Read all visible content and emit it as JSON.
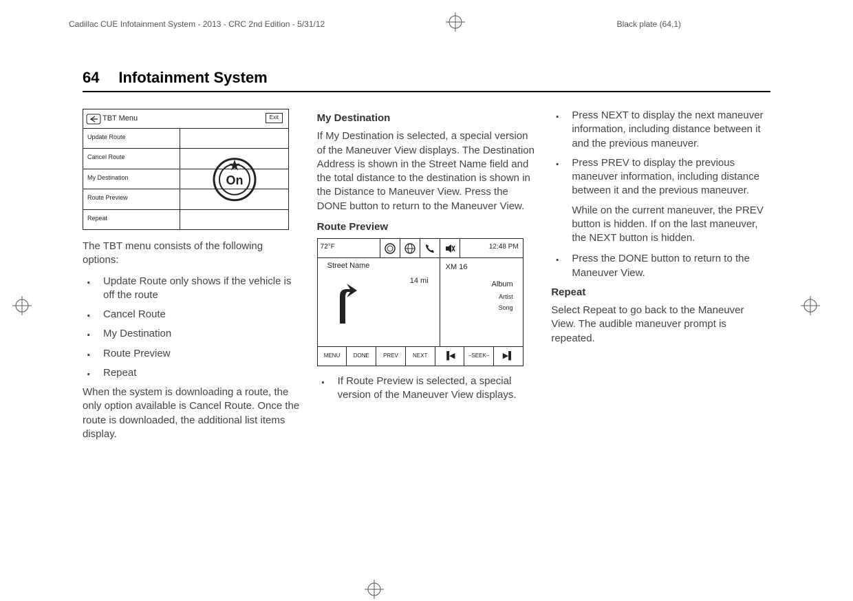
{
  "header": {
    "doc_id": "Cadillac CUE Infotainment System - 2013 - CRC 2nd Edition - 5/31/12",
    "plate": "Black plate (64,1)"
  },
  "page": {
    "number": "64",
    "title": "Infotainment System"
  },
  "col1": {
    "tbt_title": "TBT Menu",
    "tbt_exit": "Exit",
    "tbt_items": [
      "Update Route",
      "Cancel Route",
      "My Destination",
      "Route Preview",
      "Repeat"
    ],
    "intro": "The TBT menu consists of the following options:",
    "bullets": [
      "Update Route only shows if the vehicle is off the route",
      "Cancel Route",
      "My Destination",
      "Route Preview",
      "Repeat"
    ],
    "outro": "When the system is downloading a route, the only option available is Cancel Route. Once the route is downloaded, the additional list items display."
  },
  "col2": {
    "h1": "My Destination",
    "p1": "If My Destination is selected, a special version of the Maneuver View displays. The Destination Address is shown in the Street Name field and the total distance to the destination is shown in the Distance to Maneuver View. Press the DONE button to return to the Maneuver View.",
    "h2": "Route Preview",
    "rp": {
      "temp": "72°F",
      "time": "12:48 PM",
      "street": "Street Name",
      "distance": "14 mi",
      "channel": "XM 16",
      "album": "Album",
      "artist": "Artist",
      "song": "Song",
      "buttons": [
        "MENU",
        "DONE",
        "PREV",
        "NEXT"
      ],
      "seek": "–SEEK–"
    },
    "bullet1": "If Route Preview is selected, a special version of the Maneuver View displays."
  },
  "col3": {
    "bullets": [
      "Press NEXT to display the next maneuver information, including distance between it and the previous maneuver.",
      "Press PREV to display the previous maneuver information, including distance between it and the previous maneuver."
    ],
    "indent": "While on the current maneuver, the PREV button is hidden. If on the last maneuver, the NEXT button is hidden.",
    "bullet3": "Press the DONE button to return to the Maneuver View.",
    "h1": "Repeat",
    "p1": "Select Repeat to go back to the Maneuver View. The audible maneuver prompt is repeated."
  }
}
